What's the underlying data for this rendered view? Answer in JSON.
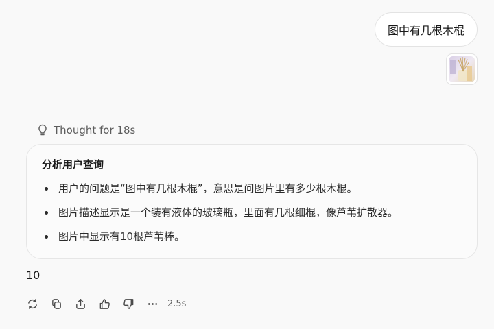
{
  "user_message": {
    "text": "图中有几根木棍",
    "attachment_icon": "image-thumbnail"
  },
  "thought": {
    "header": "Thought for 18s",
    "icon": "lightbulb-icon",
    "title": "分析用户查询",
    "bullets": [
      "用户的问题是“图中有几根木棍”，意思是问图片里有多少根木棍。",
      "图片描述显示是一个装有液体的玻璃瓶，里面有几根细棍，像芦苇扩散器。",
      "图片中显示有10根芦苇棒。"
    ]
  },
  "answer": {
    "text": "10"
  },
  "actions": {
    "icons": [
      "regenerate-icon",
      "copy-icon",
      "share-icon",
      "thumbs-up-icon",
      "thumbs-down-icon",
      "more-icon"
    ],
    "duration": "2.5s"
  },
  "colors": {
    "background": "#f9f9f9",
    "muted_text": "#5d5d5d",
    "border": "#e3e3e3"
  }
}
